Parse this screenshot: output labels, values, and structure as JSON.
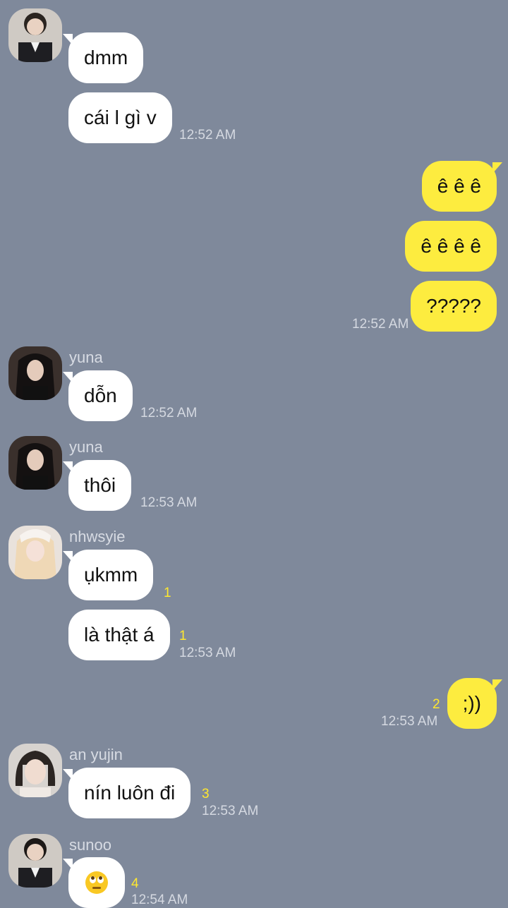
{
  "messages": {
    "m1": {
      "text": "dmm"
    },
    "m2": {
      "text": "cái l gì v",
      "time": "12:52 AM"
    },
    "m3": {
      "text": "ê ê ê"
    },
    "m4": {
      "text": "ê ê ê ê"
    },
    "m5": {
      "text": "?????",
      "time": "12:52 AM"
    },
    "m6": {
      "sender": "yuna",
      "text": "dỗn",
      "time": "12:52 AM"
    },
    "m7": {
      "sender": "yuna",
      "text": "thôi",
      "time": "12:53 AM"
    },
    "m8": {
      "sender": "nhwsyie",
      "text": "ụkmm",
      "unread": "1"
    },
    "m9": {
      "text": "là thật á",
      "unread": "1",
      "time": "12:53 AM"
    },
    "m10": {
      "text": ";))",
      "unread": "2",
      "time": "12:53 AM"
    },
    "m11": {
      "sender": "an yujin",
      "text": "nín luôn đi",
      "unread": "3",
      "time": "12:53 AM"
    },
    "m12": {
      "sender": "sunoo",
      "emoji": "face-with-rolling-eyes",
      "unread": "4",
      "time": "12:54 AM"
    }
  },
  "colors": {
    "background": "#7f899b",
    "incoming_bubble": "#ffffff",
    "outgoing_bubble": "#fdec3f",
    "unread_count": "#ffe82e"
  }
}
